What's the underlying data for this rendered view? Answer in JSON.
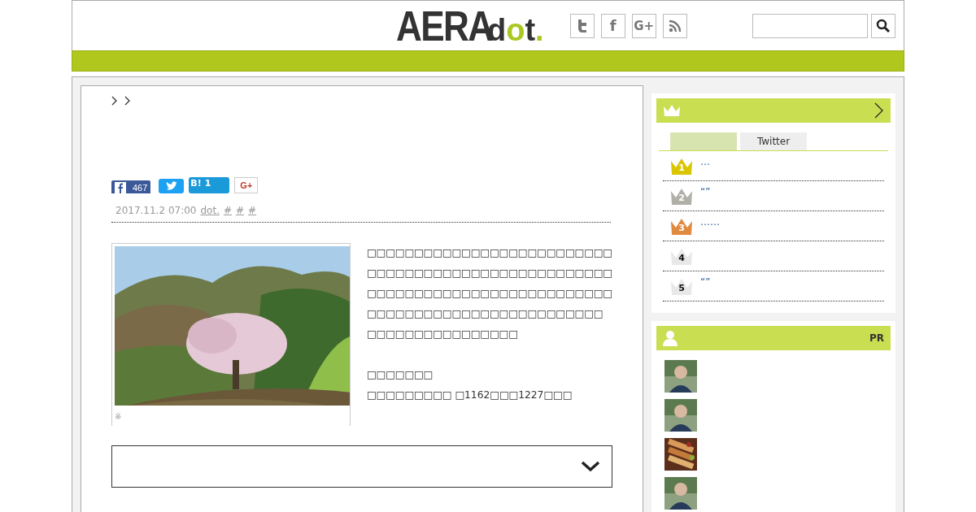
{
  "header": {
    "logo": {
      "name": "AERA",
      "parts": [
        {
          "text": "d",
          "accent": false
        },
        {
          "text": "o",
          "accent": true
        },
        {
          "text": "t",
          "accent": false
        },
        {
          "text": ".",
          "accent": true
        }
      ]
    },
    "social": [
      {
        "kind": "twitter"
      },
      {
        "kind": "facebook",
        "text": "f"
      },
      {
        "kind": "gplus",
        "text": "G+"
      },
      {
        "kind": "rss"
      }
    ]
  },
  "article": {
    "share": {
      "facebook_count": "467",
      "hatena_label": "B!",
      "hatena_count": "1",
      "gplus": "G+"
    },
    "meta": {
      "date": "2017.11.2 07:00",
      "links": [
        "dot.",
        "#",
        "#",
        "#"
      ]
    },
    "image_caption": "※",
    "body": "□□□□□□□□□□□□□□□□□□□□□□□□□□\n□□□□□□□□□□□□□□□□□□□□□□□□□□\n□□□□□□□□□□□□□□□□□□□□□□□□□□\n□□□□□□□□□□□□□□□□□□□□□□□□□\n□□□□□□□□□□□□□□□□\n\n□□□□□□□\n□□□□□□□□□ □1162□□□1227□□□"
  },
  "ranking": {
    "tabs": [
      {
        "selected": true
      },
      {
        "label": "Twitter",
        "selected": false
      }
    ],
    "items": [
      {
        "rank": "1",
        "color": "#d9c500",
        "title": "…"
      },
      {
        "rank": "2",
        "color": "#b0b0a8",
        "title": "“”"
      },
      {
        "rank": "3",
        "color": "#e08a40",
        "title": "……"
      },
      {
        "rank": "4",
        "color": "#e8e8e8"
      },
      {
        "rank": "5",
        "color": "#e8e8e8",
        "title": "“”"
      }
    ]
  },
  "pr": {
    "label": "PR",
    "items": [
      {
        "kind": "person"
      },
      {
        "kind": "person"
      },
      {
        "kind": "food"
      },
      {
        "kind": "person"
      }
    ]
  }
}
